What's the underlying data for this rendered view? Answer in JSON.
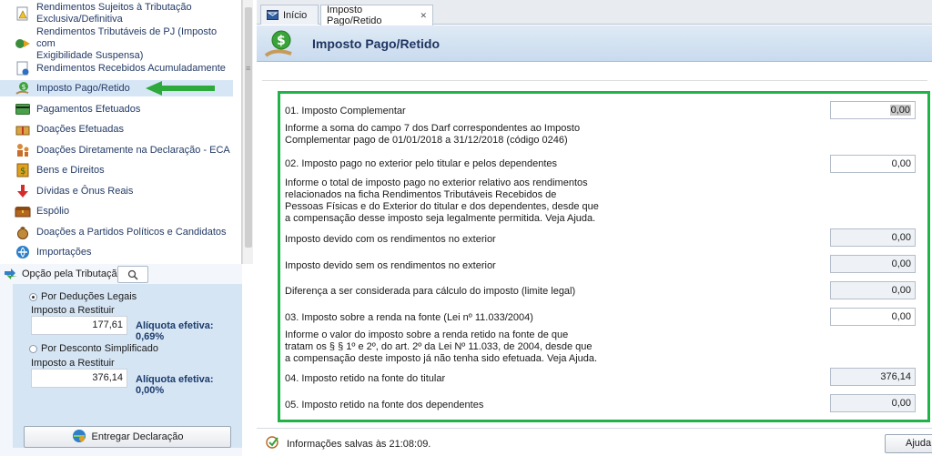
{
  "sidebar": {
    "items": [
      {
        "label1": "Rendimentos Sujeitos à Tributação",
        "label2": "Exclusiva/Definitiva",
        "icon": "warning-doc-icon"
      },
      {
        "label1": "Rendimentos Tributáveis de PJ (Imposto com",
        "label2": "Exigibilidade Suspensa)",
        "icon": "exchange-icon"
      },
      {
        "label1": "Rendimentos Recebidos Acumuladamente",
        "icon": "doc-icon"
      },
      {
        "label1": "Imposto Pago/Retido",
        "icon": "money-hand-icon"
      },
      {
        "label1": "Pagamentos Efetuados",
        "icon": "card-icon"
      },
      {
        "label1": "Doações Efetuadas",
        "icon": "gift-icon"
      },
      {
        "label1": "Doações Diretamente na Declaração - ECA",
        "icon": "family-icon"
      },
      {
        "label1": "Bens e Direitos",
        "icon": "dollar-doc-icon"
      },
      {
        "label1": "Dívidas e Ônus Reais",
        "icon": "down-arrow-icon"
      },
      {
        "label1": "Espólio",
        "icon": "chest-icon"
      },
      {
        "label1": "Doações a Partidos Políticos e Candidatos",
        "icon": "bag-icon"
      },
      {
        "label1": "Importações",
        "icon": "import-icon"
      }
    ]
  },
  "opcao": {
    "title": "Opção pela Tributação:",
    "deducoes": {
      "label": "Por Deduções Legais",
      "sub": "Imposto a Restituir",
      "value": "177,61",
      "aliquota": "Alíquota efetiva: 0,69%"
    },
    "simplificado": {
      "label": "Por Desconto Simplificado",
      "sub": "Imposto a Restituir",
      "value": "376,14",
      "aliquota": "Alíquota efetiva: 0,00%"
    },
    "entregar": "Entregar Declaração"
  },
  "tabs": {
    "inicio": "Início",
    "active": "Imposto Pago/Retido"
  },
  "header": {
    "title": "Imposto Pago/Retido"
  },
  "form": {
    "f01_label": "01.  Imposto Complementar",
    "f01_value": "0,00",
    "f01_help1": "Informe a soma do campo 7 dos Darf correspondentes ao Imposto",
    "f01_help2": "Complementar pago de 01/01/2018 a 31/12/2018 (código 0246)",
    "f02_label": "02.  Imposto pago no exterior pelo titular e pelos dependentes",
    "f02_value": "0,00",
    "f02_help1": "Informe o total de imposto pago no exterior relativo aos rendimentos",
    "f02_help2": "relacionados na ficha Rendimentos Tributáveis Recebidos de",
    "f02_help3": "Pessoas Físicas e do Exterior do titular e dos dependentes, desde que",
    "f02_help4": "a compensação desse imposto seja legalmente permitida. Veja Ajuda.",
    "devido_com_label": "Imposto devido com os rendimentos no exterior",
    "devido_com_value": "0,00",
    "devido_sem_label": "Imposto devido sem os rendimentos no exterior",
    "devido_sem_value": "0,00",
    "diferenca_label": "Diferença a ser considerada para cálculo do imposto (limite legal)",
    "diferenca_value": "0,00",
    "f03_label": "03.  Imposto sobre a renda na fonte (Lei nº 11.033/2004)",
    "f03_value": "0,00",
    "f03_help1": "Informe o valor do imposto sobre a renda retido na fonte de que",
    "f03_help2": "tratam os § § 1º e 2º, do art. 2º da Lei Nº 11.033, de 2004, desde que",
    "f03_help3": "a compensação deste imposto já não tenha sido efetuada. Veja Ajuda.",
    "f04_label": "04.  Imposto retido na fonte do titular",
    "f04_value": "376,14",
    "f05_label": "05.  Imposto retido na fonte dos dependentes",
    "f05_value": "0,00"
  },
  "status": {
    "text": "Informações salvas às 21:08:09.",
    "ajuda": "Ajuda"
  },
  "colors": {
    "highlight_border": "#21b24a",
    "arrow": "#2eaa3c",
    "title": "#1f3562"
  }
}
